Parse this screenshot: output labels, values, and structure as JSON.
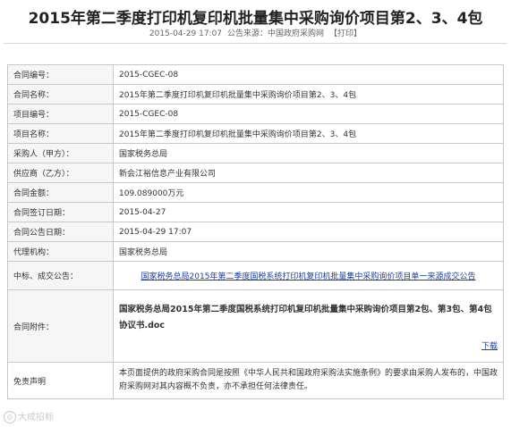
{
  "title": "2015年第二季度打印机复印机批量集中采购询价项目第2、3、4包",
  "meta": {
    "datetime": "2015-04-29 17:07",
    "source_label": "公告来源：中国政府采购网",
    "print_label": "【打印】"
  },
  "rows": {
    "contract_no": {
      "label": "合同编号：",
      "value": "2015-CGEC-08"
    },
    "contract_name": {
      "label": "合同名称：",
      "value": "2015年第二季度打印机复印机批量集中采购询价项目第2、3、4包"
    },
    "project_no": {
      "label": "项目编号：",
      "value": "2015-CGEC-08"
    },
    "project_name": {
      "label": "项目名称：",
      "value": "2015年第二季度打印机复印机批量集中采购询价项目第2、3、4包"
    },
    "buyer": {
      "label": "采购人（甲方）：",
      "value": "国家税务总局"
    },
    "supplier": {
      "label": "供应商（乙方）：",
      "value": "新会江裕信息产业有限公司"
    },
    "amount": {
      "label": "合同金额：",
      "value": "109.089000万元"
    },
    "sign_date": {
      "label": "合同签订日期：",
      "value": "2015-04-27"
    },
    "announce_date": {
      "label": "合同公告日期：",
      "value": "2015-04-29 17:07"
    },
    "agency": {
      "label": "代理机构：",
      "value": "国家税务总局"
    },
    "winning": {
      "label": "中标、成交公告：",
      "link": "国家税务总局2015年第二季度国税系统打印机复印机批量集中采购询价项目单一来源成交公告"
    },
    "attachment": {
      "label": "合同附件：",
      "filename": "国家税务总局2015年第二季度国税系统打印机复印机批量集中采购询价项目第2包、第3包、第4包协议书.doc",
      "download": "下载"
    },
    "disclaimer": {
      "label": "免责声明",
      "text": "本页面提供的政府采购合同是按照《中华人民共和国政府采购法实施条例》的要求由采购人发布的，中国政府采购网对其内容概不负责，亦不承担任何法律责任。"
    }
  },
  "watermark": "大成招标"
}
